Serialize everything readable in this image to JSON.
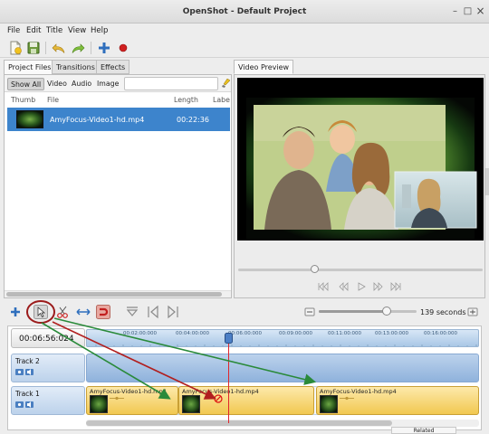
{
  "window": {
    "title": "OpenShot - Default Project",
    "controls": {
      "minimize": "–",
      "maximize": "□",
      "close": "×"
    }
  },
  "menubar": [
    "File",
    "Edit",
    "Title",
    "View",
    "Help"
  ],
  "toolbar": {
    "icons": [
      "new-project-icon",
      "save-project-icon",
      "undo-icon",
      "redo-icon",
      "add-files-icon",
      "record-icon"
    ]
  },
  "left_tabs": [
    "Project Files",
    "Transitions",
    "Effects"
  ],
  "filters": {
    "buttons": [
      "Show All",
      "Video",
      "Audio",
      "Image"
    ],
    "search_value": ""
  },
  "file_columns": [
    "Thumb",
    "File",
    "Length",
    "Labe"
  ],
  "files": [
    {
      "name": "AmyFocus-Video1-hd.mp4",
      "length": "00:22:36",
      "selected": true
    }
  ],
  "preview": {
    "tab": "Video Preview",
    "seek_position": 0.3,
    "transport_icons": [
      "jump-start-icon",
      "rewind-icon",
      "play-icon",
      "fast-forward-icon",
      "jump-end-icon"
    ]
  },
  "timeline_toolbar": {
    "icons": [
      "add-track-icon",
      "arrow-tool-icon",
      "razor-tool-icon",
      "resize-tool-icon",
      "snap-tool-icon",
      "marker-icon",
      "previous-marker-icon",
      "next-marker-icon",
      "zoom-out-icon",
      "zoom-in-icon"
    ],
    "zoom_seconds": "139 seconds",
    "zoom_level": 0.7
  },
  "timeline": {
    "current_time": "00:06:56:024",
    "ruler_labels": [
      "00:02:00:000",
      "00:04:00:000",
      "00:06:00:000",
      "00:09:00:000",
      "00:11:00:000",
      "00:13:00:000",
      "00:16:00:000"
    ],
    "tracks": [
      {
        "name": "Track 2",
        "clips": []
      },
      {
        "name": "Track 1",
        "clips": [
          {
            "name": "AmyFocus-Video1-hd.mp4"
          },
          {
            "name": "AmyFocus-Video1-hd.mp4"
          },
          {
            "name": "AmyFocus-Video1-hd.mp4"
          }
        ]
      }
    ],
    "scroll_position": 0.78
  },
  "status": {
    "related_tab": "Related"
  },
  "annotation_colors": {
    "circle": "#9b1b1b",
    "arrow_red": "#b11f1f",
    "arrow_green": "#2a8a3a"
  }
}
